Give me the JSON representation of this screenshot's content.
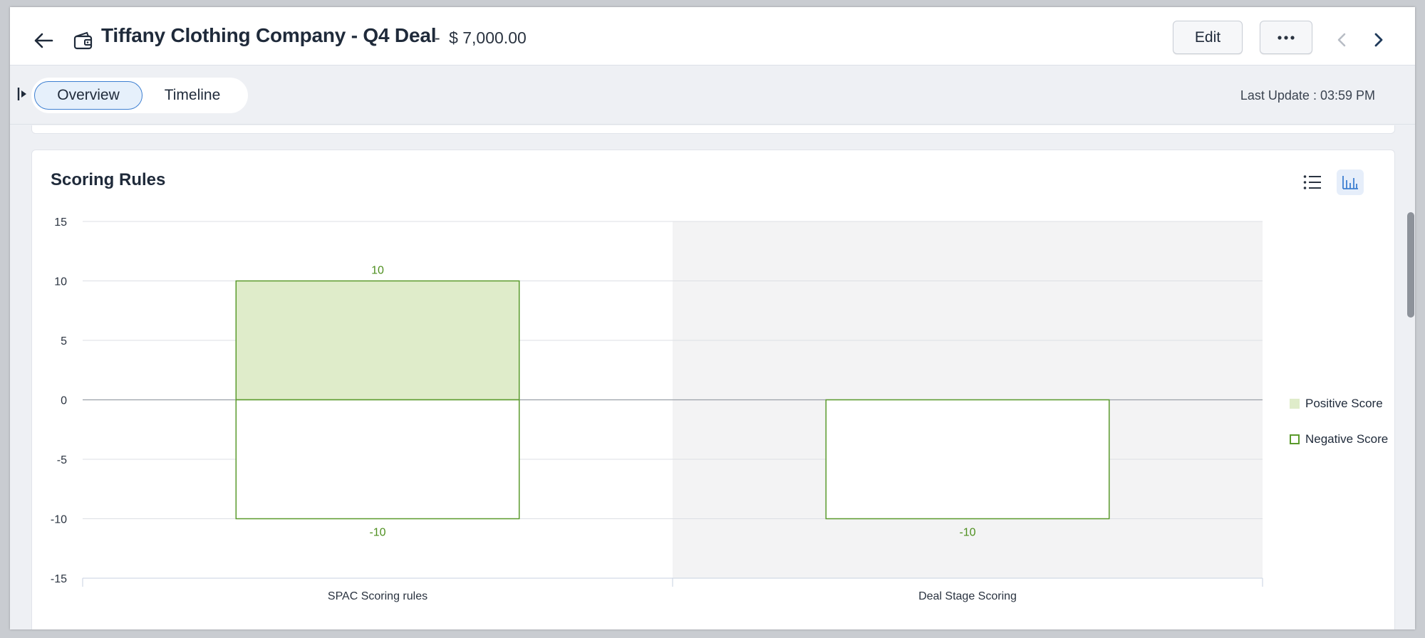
{
  "header": {
    "title": "Tiffany Clothing Company - Q4 Deal",
    "amount_separator": "-",
    "amount": "$ 7,000.00",
    "edit_label": "Edit",
    "more_label": "•••"
  },
  "tabs": [
    {
      "label": "Overview",
      "active": true
    },
    {
      "label": "Timeline",
      "active": false
    }
  ],
  "last_update": "Last Update : 03:59 PM",
  "card": {
    "title": "Scoring Rules"
  },
  "icons": {
    "back": "arrow-left-icon",
    "deal": "wallet-icon",
    "more": "ellipsis-icon",
    "prev": "chevron-left-icon",
    "next": "chevron-right-icon",
    "list_view": "list-icon",
    "chart_view": "bar-chart-icon"
  },
  "colors": {
    "positive_fill": "#dfecca",
    "bar_stroke": "#5a9a2c",
    "label_green": "#4e8f1f",
    "shaded_band": "#f3f3f4",
    "accent": "#3d7fd1"
  },
  "chart_data": {
    "type": "bar",
    "title": "",
    "categories": [
      "SPAC Scoring rules",
      "Deal Stage Scoring"
    ],
    "series": [
      {
        "name": "Positive Score",
        "values": [
          10,
          0
        ]
      },
      {
        "name": "Negative Score",
        "values": [
          -10,
          -10
        ]
      }
    ],
    "data_labels": {
      "positive": [
        "10",
        ""
      ],
      "negative": [
        "-10",
        "-10"
      ]
    },
    "y_ticks": [
      15,
      10,
      5,
      0,
      -5,
      -10,
      -15
    ],
    "ylim": [
      -15,
      15
    ],
    "grid": true,
    "legend_position": "right"
  }
}
